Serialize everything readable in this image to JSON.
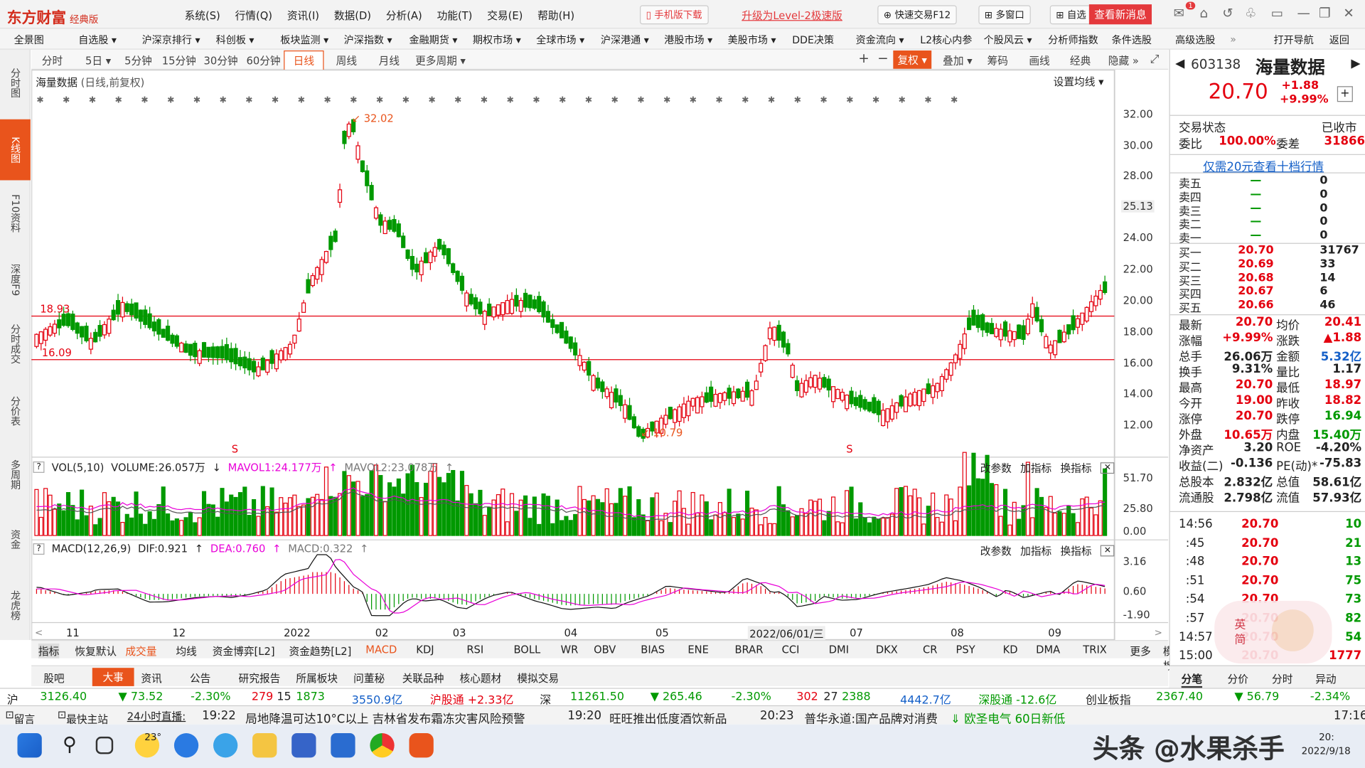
{
  "app": {
    "logo": "东方财富",
    "edition": "经典版"
  },
  "menu": [
    "系统(S)",
    "行情(Q)",
    "资讯(I)",
    "数据(D)",
    "分析(A)",
    "功能(T)",
    "交易(E)",
    "帮助(H)"
  ],
  "titlebar": {
    "mobile": "手机版下载",
    "upgrade": "升级为Level-2极速版",
    "quicktrade": "快速交易F12",
    "multiwin": "多窗口",
    "self": "自选",
    "news": "查看新消息",
    "badge": "1"
  },
  "nav": [
    "全景图",
    "自选股 ▾",
    "沪深京排行 ▾",
    "科创板 ▾",
    "板块监测 ▾",
    "沪深指数 ▾",
    "金融期货 ▾",
    "期权市场 ▾",
    "全球市场 ▾",
    "沪深港通 ▾",
    "港股市场 ▾",
    "美股市场 ▾",
    "DDE决策",
    "资金流向 ▾",
    "L2核心内参",
    "个股风云 ▾",
    "分析师指数",
    "条件选股",
    "高级选股",
    "»",
    "打开导航",
    "返回"
  ],
  "lefttabs": [
    "分时图",
    "K线图",
    "F10资料",
    "深度F9",
    "分时成交",
    "分价表",
    "多周期",
    "资金",
    "龙虎榜"
  ],
  "periods": [
    "分时",
    "5日 ▾",
    "5分钟",
    "15分钟",
    "30分钟",
    "60分钟",
    "日线",
    "周线",
    "月线",
    "更多周期 ▾"
  ],
  "tools": [
    "+",
    "−",
    "复权 ▾",
    "叠加 ▾",
    "筹码",
    "画线",
    "经典",
    "隐藏 »"
  ],
  "chart_head": {
    "name": "海量数据",
    "mode": "(日线,前复权)",
    "setma": "设置均线 ▾"
  },
  "kline_labels": {
    "high": "32.02",
    "low": "10.79",
    "line1": "18.93",
    "line2": "16.09",
    "cursor": "25.13"
  },
  "price_axis": [
    "32.00",
    "30.00",
    "28.00",
    "24.00",
    "22.00",
    "20.00",
    "18.00",
    "16.00",
    "14.00",
    "12.00"
  ],
  "vol_head": {
    "name": "VOL(5,10)",
    "vol": "VOLUME:26.057万",
    "ma1": "MAVOL1:24.177万",
    "ma2": "MAVOL2:23.078万",
    "btns": [
      "改参数",
      "加指标",
      "换指标"
    ]
  },
  "vol_axis": [
    "51.70",
    "25.80",
    "0.00"
  ],
  "macd_head": {
    "name": "MACD(12,26,9)",
    "dif": "DIF:0.921",
    "dea": "DEA:0.760",
    "macd": "MACD:0.322"
  },
  "macd_axis": [
    "3.16",
    "0.60",
    "-1.90"
  ],
  "date_axis": [
    "11",
    "12",
    "2022",
    "02",
    "03",
    "04",
    "05",
    "2022/06/01/三",
    "07",
    "08",
    "09"
  ],
  "indicators": [
    "指标",
    "恢复默认",
    "成交量",
    "均线",
    "资金博弈[L2]",
    "资金趋势[L2]",
    "MACD",
    "KDJ",
    "RSI",
    "BOLL",
    "WR",
    "OBV",
    "BIAS",
    "ENE",
    "BRAR",
    "CCI",
    "DMI",
    "DKX",
    "CR",
    "PSY",
    "KD",
    "DMA",
    "TRIX",
    "更多",
    "模板"
  ],
  "newstabs": [
    "股吧",
    "大事",
    "资讯",
    "公告",
    "研究报告",
    "所属板块",
    "问董秘",
    "关联品种",
    "核心题材",
    "模拟交易"
  ],
  "stock": {
    "code": "603138",
    "name": "海量数据",
    "price": "20.70",
    "chg": "+1.88",
    "pct": "+9.99%",
    "status_l": "交易状态",
    "status_r": "已收市",
    "wb_l": "委比",
    "wb": "100.00%",
    "wc_l": "委差",
    "wc": "31866",
    "promo": "仅需20元查看十档行情"
  },
  "asks": [
    [
      "卖五",
      "—",
      "0"
    ],
    [
      "卖四",
      "—",
      "0"
    ],
    [
      "卖三",
      "—",
      "0"
    ],
    [
      "卖二",
      "—",
      "0"
    ],
    [
      "卖一",
      "—",
      "0"
    ]
  ],
  "bids": [
    [
      "买一",
      "20.70",
      "31767"
    ],
    [
      "买二",
      "20.69",
      "33"
    ],
    [
      "买三",
      "20.68",
      "14"
    ],
    [
      "买四",
      "20.67",
      "6"
    ],
    [
      "买五",
      "20.66",
      "46"
    ]
  ],
  "stats": [
    [
      "最新",
      "20.70",
      "均价",
      "20.41"
    ],
    [
      "涨幅",
      "+9.99%",
      "涨跌",
      "▲1.88"
    ],
    [
      "总手",
      "26.06万",
      "金额",
      "5.32亿"
    ],
    [
      "换手",
      "9.31%",
      "量比",
      "1.17"
    ],
    [
      "最高",
      "20.70",
      "最低",
      "18.97"
    ],
    [
      "今开",
      "19.00",
      "昨收",
      "18.82"
    ],
    [
      "涨停",
      "20.70",
      "跌停",
      "16.94"
    ],
    [
      "外盘",
      "10.65万",
      "内盘",
      "15.40万"
    ],
    [
      "净资产",
      "3.20",
      "ROE",
      "-4.20%"
    ],
    [
      "收益(二)",
      "-0.136",
      "PE(动)*",
      "-75.83"
    ],
    [
      "总股本",
      "2.832亿",
      "总值",
      "58.61亿"
    ],
    [
      "流通股",
      "2.798亿",
      "流值",
      "57.93亿"
    ]
  ],
  "ticks": [
    [
      "14:56",
      "20.70",
      "10"
    ],
    [
      ":45",
      "20.70",
      "21"
    ],
    [
      ":48",
      "20.70",
      "13"
    ],
    [
      ":51",
      "20.70",
      "75"
    ],
    [
      ":54",
      "20.70",
      "73"
    ],
    [
      ":57",
      "20.70",
      "82"
    ],
    [
      "14:57",
      "20.70",
      "54"
    ],
    [
      "15:00",
      "20.70",
      "1777"
    ]
  ],
  "rp_tabs": [
    "分笔",
    "分价",
    "分时",
    "异动"
  ],
  "index": {
    "sh": "沪",
    "sh_v": "3126.40",
    "sh_c": "▼ 73.52",
    "sh_p": "-2.30%",
    "sh_n": "279",
    "sh_n2": "15",
    "sh_n3": "1873",
    "sh_amt": "3550.9亿",
    "hgt": "沪股通 +2.33亿",
    "sz": "深",
    "sz_v": "11261.50",
    "sz_c": "▼ 265.46",
    "sz_p": "-2.30%",
    "sz_n": "302",
    "sz_n2": "27",
    "sz_n3": "2388",
    "sz_amt": "4442.7亿",
    "sgt": "深股通 -12.6亿",
    "cy": "创业板指",
    "cy_v": "2367.40",
    "cy_c": "▼ 56.79",
    "cy_p": "-2.34%"
  },
  "ticker": {
    "l1": "留言",
    "l2": "最快主站",
    "l3": "24小时直播:",
    "n1t": "19:22",
    "n1": "局地降温可达10°C以上 吉林省发布霜冻灾害风险预警",
    "n2t": "19:20",
    "n2": "旺旺推出低度酒饮新品",
    "n3t": "20:23",
    "n3": "普华永道:国产品牌对消费",
    "n4": "⇓ 欧圣电气 60日新低",
    "time": "17:16"
  },
  "taskbar": {
    "temp": "23°",
    "date": "2022/9/18",
    "time": "20:"
  },
  "watermark": "头条 @水果杀手",
  "sticker": "英 简"
}
